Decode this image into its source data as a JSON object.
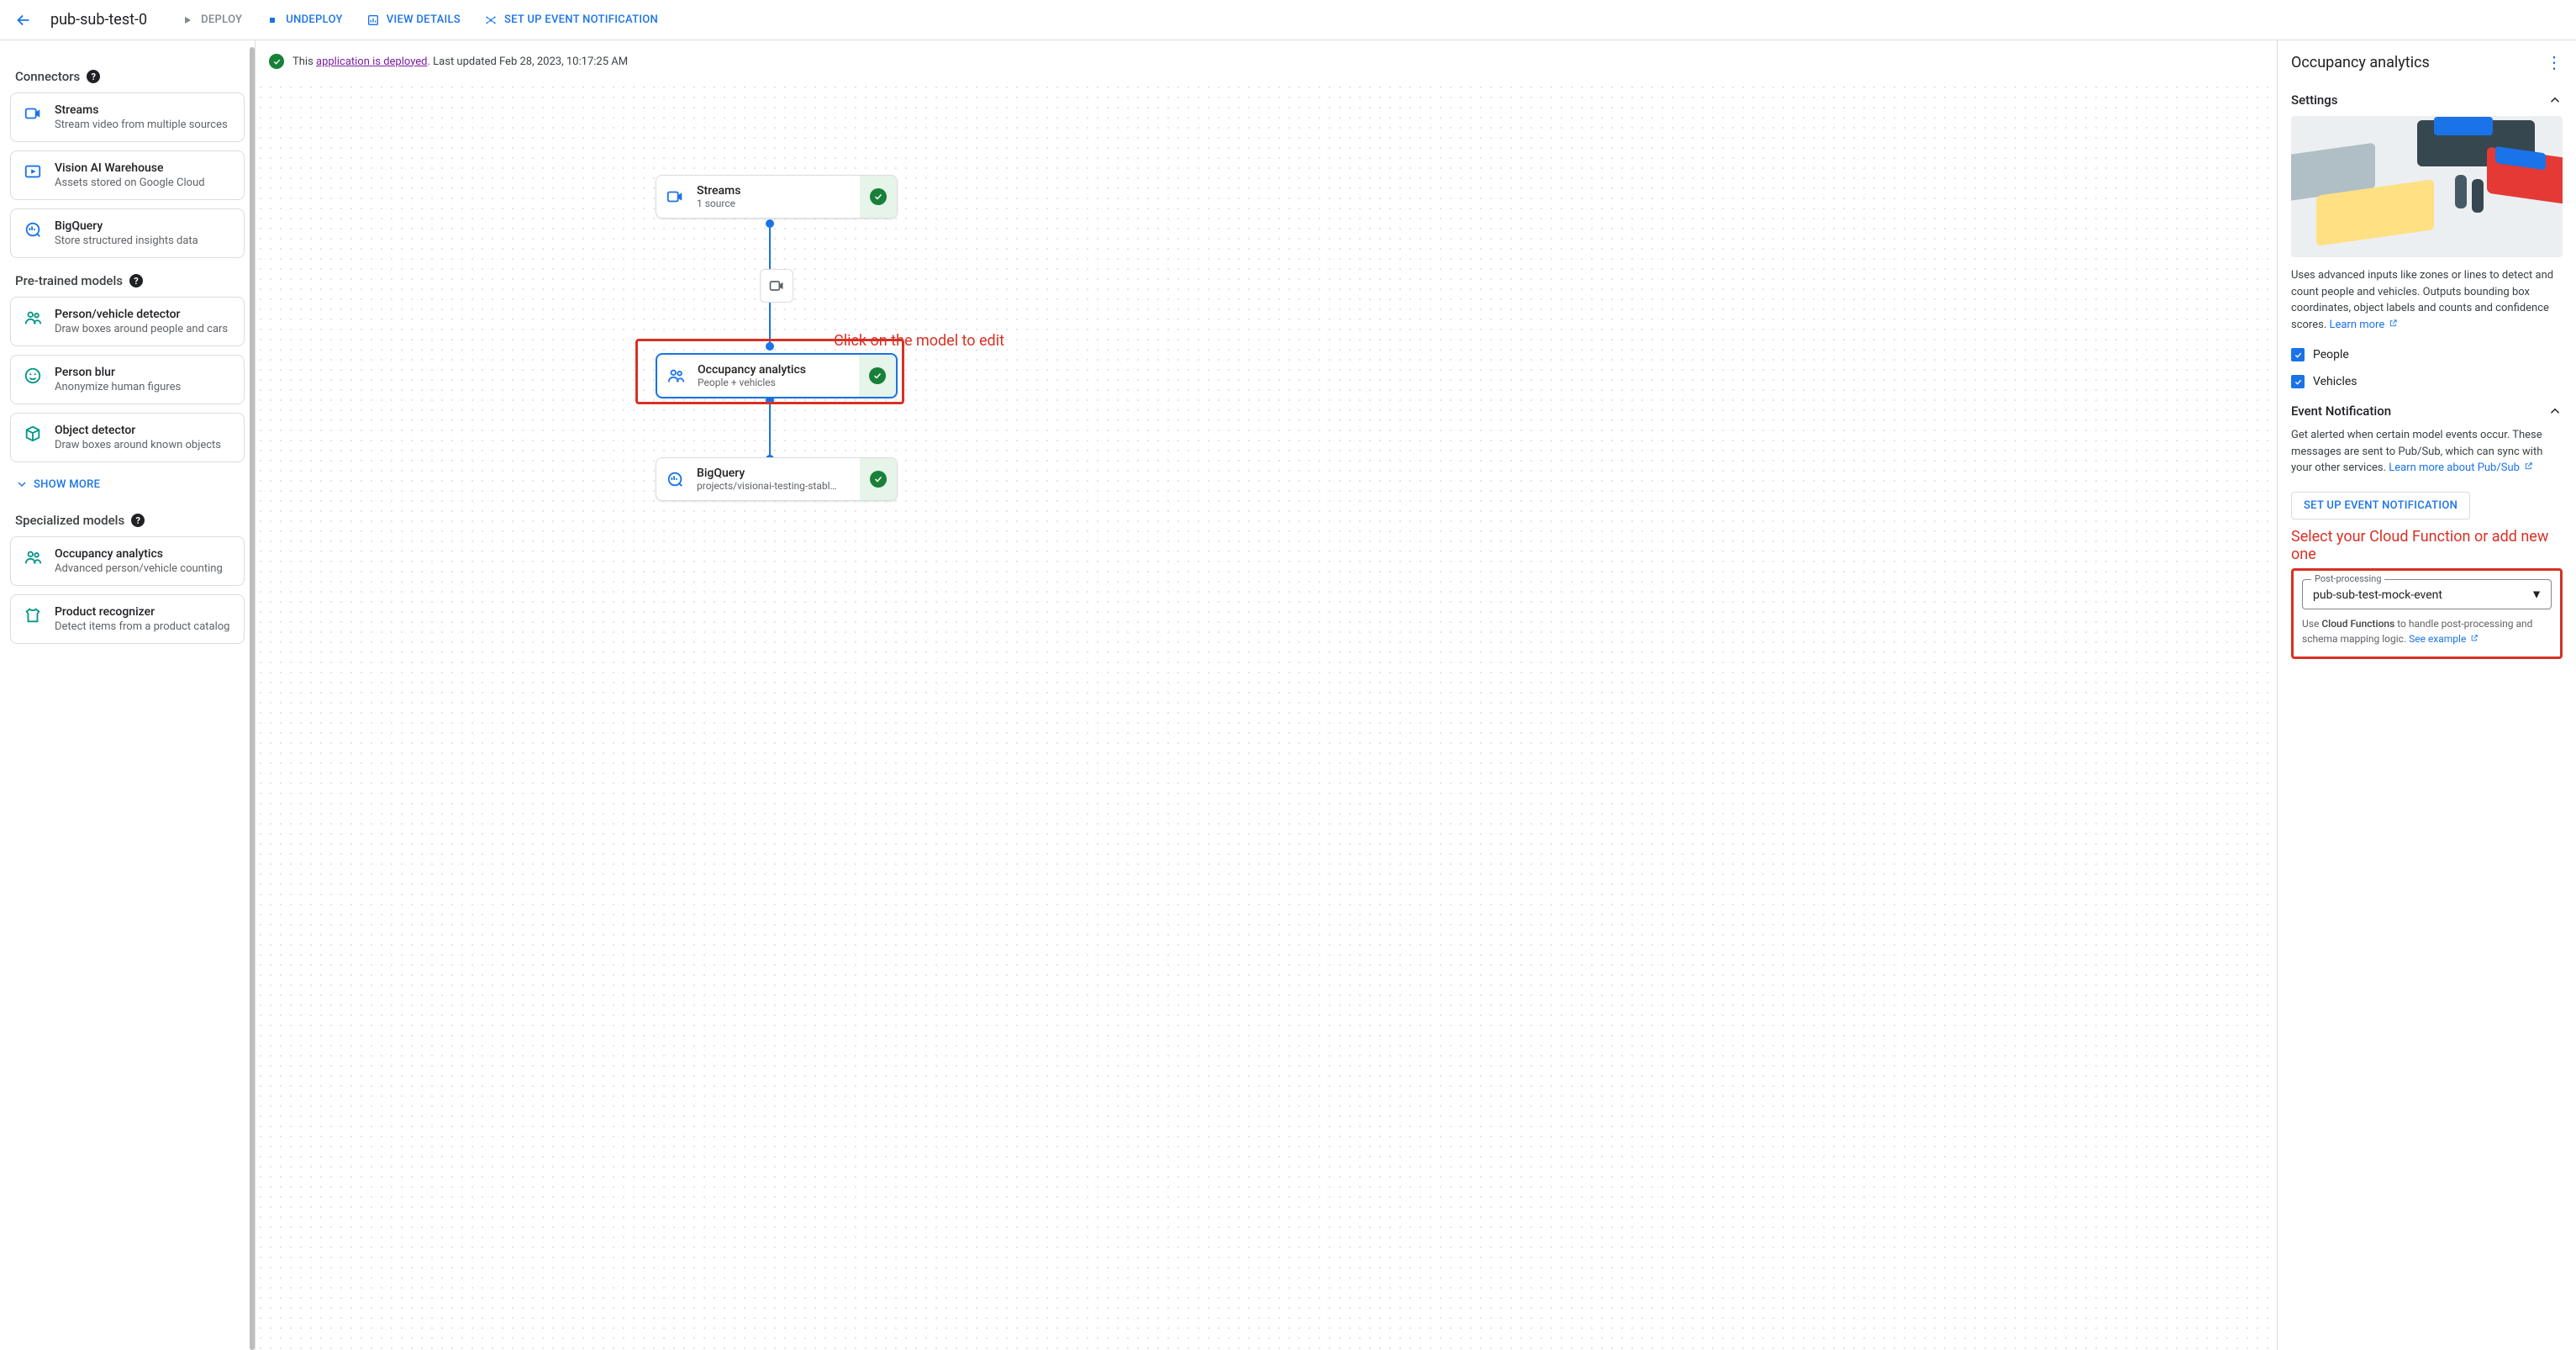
{
  "header": {
    "title": "pub-sub-test-0",
    "deploy": "DEPLOY",
    "undeploy": "UNDEPLOY",
    "view_details": "VIEW DETAILS",
    "set_up_event": "SET UP EVENT NOTIFICATION"
  },
  "status": {
    "prefix": "This ",
    "link": "application is deployed",
    "suffix": ". Last updated Feb 28, 2023, 10:17:25 AM"
  },
  "sidebar": {
    "sections": {
      "connectors": "Connectors",
      "pretrained": "Pre-trained models",
      "specialized": "Specialized models"
    },
    "connectors": [
      {
        "title": "Streams",
        "sub": "Stream video from multiple sources",
        "icon": "camera"
      },
      {
        "title": "Vision AI Warehouse",
        "sub": "Assets stored on Google Cloud",
        "icon": "play-box"
      },
      {
        "title": "BigQuery",
        "sub": "Store structured insights data",
        "icon": "bq"
      }
    ],
    "pretrained": [
      {
        "title": "Person/vehicle detector",
        "sub": "Draw boxes around people and cars",
        "icon": "people",
        "teal": true
      },
      {
        "title": "Person blur",
        "sub": "Anonymize human figures",
        "icon": "face",
        "teal": true
      },
      {
        "title": "Object detector",
        "sub": "Draw boxes around known objects",
        "icon": "cube",
        "teal": true
      }
    ],
    "show_more": "SHOW MORE",
    "specialized": [
      {
        "title": "Occupancy analytics",
        "sub": "Advanced person/vehicle counting",
        "icon": "people",
        "teal": true
      },
      {
        "title": "Product recognizer",
        "sub": "Detect items from a product catalog",
        "icon": "shirt",
        "teal": true
      }
    ]
  },
  "graph": {
    "streams": {
      "title": "Streams",
      "sub": "1 source"
    },
    "occupancy": {
      "title": "Occupancy analytics",
      "sub": "People + vehicles"
    },
    "bigquery": {
      "title": "BigQuery",
      "sub": "projects/visionai-testing-stabl…"
    }
  },
  "callouts": {
    "model_edit": "Click on the model to edit",
    "cloud_fn": "Select your Cloud Function or add new one"
  },
  "panel": {
    "title": "Occupancy analytics",
    "settings_title": "Settings",
    "settings_desc": "Uses advanced inputs like zones or lines to detect and count people and vehicles. Outputs bounding box coordinates, object labels and counts and confidence scores. ",
    "learn_more": "Learn more",
    "people": "People",
    "vehicles": "Vehicles",
    "event_title": "Event Notification",
    "event_desc": "Get alerted when certain model events occur. These messages are sent to Pub/Sub, which can sync with your other services. ",
    "event_link": "Learn more about Pub/Sub",
    "setup_btn": "SET UP EVENT NOTIFICATION",
    "pp_label": "Post-processing",
    "pp_value": "pub-sub-test-mock-event",
    "pp_hint_pre": "Use ",
    "pp_hint_bold": "Cloud Functions",
    "pp_hint_post": " to handle post-processing and schema mapping logic. ",
    "pp_example": "See example"
  }
}
